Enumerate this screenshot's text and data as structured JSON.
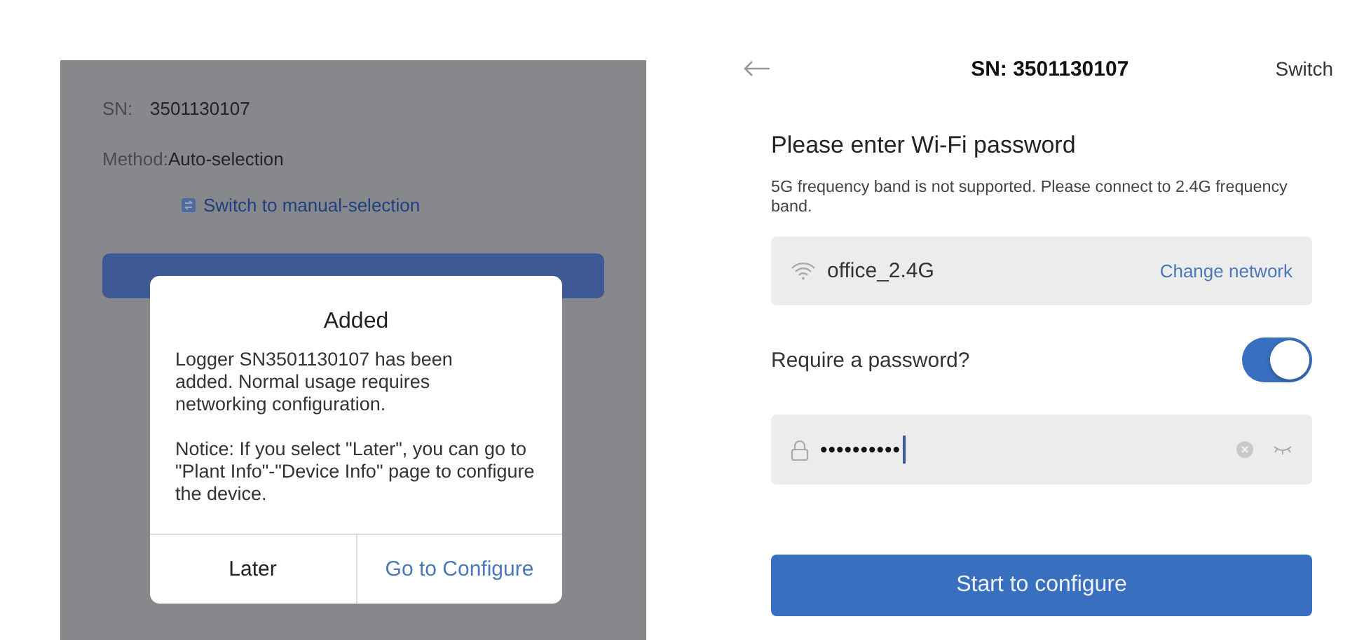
{
  "left_screen": {
    "sn_label": "SN:",
    "sn_value": "3501130107",
    "method_label": "Method:",
    "method_value": "Auto-selection",
    "switch_link": "Switch to manual-selection",
    "dialog": {
      "title": "Added",
      "message": "Logger SN3501130107 has been added. Normal usage requires networking configuration.",
      "notice": "Notice: If you select \"Later\", you can go to \"Plant Info\"-\"Device Info\" page to configure the device.",
      "buttons": [
        {
          "label": "Later",
          "kind": "plain"
        },
        {
          "label": "Go to Configure",
          "kind": "primary"
        }
      ]
    }
  },
  "right_screen": {
    "header": {
      "title": "SN: 3501130107",
      "action": "Switch"
    },
    "heading": "Please enter Wi-Fi password",
    "note": "5G frequency band is not supported. Please connect to 2.4G frequency band.",
    "network": {
      "name": "office_2.4G",
      "action": "Change network"
    },
    "require_password": {
      "label": "Require a password?",
      "on": true
    },
    "password": {
      "value": "••••••••••"
    },
    "submit": "Start to configure"
  }
}
